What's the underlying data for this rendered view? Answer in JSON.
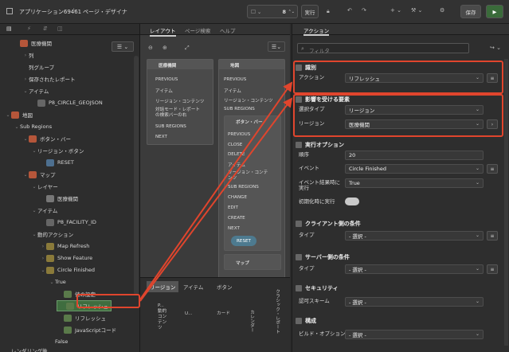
{
  "topbar": {
    "app_title": "アプリケーション69461",
    "page_title": "ページ・デザイナ",
    "page_number": "8",
    "run_label": "実行",
    "save_label": "保存"
  },
  "left": {
    "items": [
      {
        "label": "医療機関",
        "indent": 1,
        "icon": "region"
      },
      {
        "label": "列",
        "indent": 2,
        "chev": "›"
      },
      {
        "label": "列グループ",
        "indent": 2
      },
      {
        "label": "保存されたレポート",
        "indent": 2,
        "chev": "›"
      },
      {
        "label": "アイテム",
        "indent": 2,
        "chev": "⌄"
      },
      {
        "label": "P8_CIRCLE_GEOJSON",
        "indent": 3,
        "icon": "hidden"
      },
      {
        "label": "地図",
        "indent": 0,
        "chev": "⌄",
        "icon": "region"
      },
      {
        "label": "Sub Regions",
        "indent": 1,
        "chev": "⌄"
      },
      {
        "label": "ボタン・バー",
        "indent": 2,
        "chev": "⌄",
        "icon": "region"
      },
      {
        "label": "リージョン・ボタン",
        "indent": 3,
        "chev": "⌄"
      },
      {
        "label": "RESET",
        "indent": 4,
        "icon": "button"
      },
      {
        "label": "マップ",
        "indent": 2,
        "chev": "⌄",
        "icon": "map"
      },
      {
        "label": "レイヤー",
        "indent": 3,
        "chev": "⌄"
      },
      {
        "label": "医療機関",
        "indent": 4,
        "icon": "layer"
      },
      {
        "label": "アイテム",
        "indent": 3,
        "chev": "⌄"
      },
      {
        "label": "P8_FACILITY_ID",
        "indent": 4,
        "icon": "hidden"
      },
      {
        "label": "動的アクション",
        "indent": 3,
        "chev": "⌄"
      },
      {
        "label": "Map Refresh",
        "indent": 4,
        "chev": "›",
        "icon": "da"
      },
      {
        "label": "Show Feature",
        "indent": 4,
        "chev": "›",
        "icon": "da"
      },
      {
        "label": "Circle Finished",
        "indent": 4,
        "chev": "⌄",
        "icon": "da"
      },
      {
        "label": "True",
        "indent": 5,
        "chev": "⌄"
      },
      {
        "label": "値の設定",
        "indent": 6,
        "icon": "act"
      },
      {
        "label": "リフレッシュ",
        "indent": 6,
        "icon": "act",
        "selected": true
      },
      {
        "label": "リフレッシュ",
        "indent": 6,
        "icon": "act"
      },
      {
        "label": "JavaScriptコード",
        "indent": 6,
        "icon": "act"
      },
      {
        "label": "False",
        "indent": 5
      },
      {
        "label": "レンダリング後",
        "indent": 0
      }
    ]
  },
  "mid": {
    "tabs": [
      "レイアウト",
      "ページ検索",
      "ヘルプ"
    ],
    "card1": {
      "title": "医療機関",
      "rows": [
        "PREVIOUS",
        "アイテム",
        "リージョン・コンテンツ",
        "対話モード・レポート\nの検索バーの右",
        "SUB REGIONS",
        "NEXT"
      ]
    },
    "card2": {
      "title": "地図",
      "rows": [
        "PREVIOUS",
        "アイテム",
        "リージョン・コンテンツ",
        "SUB REGIONS"
      ]
    },
    "card3": {
      "title": "ボタン・バー",
      "rows": [
        "PREVIOUS",
        "CLOSE",
        "DELETE",
        "アイテム",
        "リージョン・コンテ\nンツ",
        "SUB REGIONS",
        "CHANGE",
        "EDIT",
        "CREATE",
        "NEXT"
      ]
    },
    "reset": "RESET",
    "card4": "マップ",
    "btabs": [
      "リージョン",
      "アイテム",
      "ボタン"
    ],
    "gallery": [
      "P...\n動的コンテンツ",
      "U...",
      "カード",
      "カレンダー",
      "クラシック・レポート"
    ]
  },
  "right": {
    "tab": "アクション",
    "filter_placeholder": "フィルタ",
    "sections": [
      {
        "title": "識別",
        "rows": [
          {
            "label": "アクション",
            "value": "リフレッシュ",
            "btn": "≡"
          }
        ]
      },
      {
        "title": "影響を受ける要素",
        "rows": [
          {
            "label": "選択タイプ",
            "value": "リージョン"
          },
          {
            "label": "リージョン",
            "value": "医療機関",
            "btn": "›"
          }
        ]
      },
      {
        "title": "実行オプション",
        "rows": [
          {
            "label": "順序",
            "value": "20"
          },
          {
            "label": "イベント",
            "value": "Circle Finished",
            "btn": "≡"
          },
          {
            "label": "イベント結果時に\n実行",
            "value": "True"
          },
          {
            "label": "初期化時に実行",
            "value": ""
          }
        ]
      },
      {
        "title": "クライアント側の条件",
        "rows": [
          {
            "label": "タイプ",
            "value": "- 選択 -",
            "btn": "≡"
          }
        ]
      },
      {
        "title": "サーバー側の条件",
        "rows": [
          {
            "label": "タイプ",
            "value": "- 選択 -",
            "btn": "≡"
          }
        ]
      },
      {
        "title": "セキュリティ",
        "rows": [
          {
            "label": "認可スキーム",
            "value": "- 選択 -"
          }
        ]
      },
      {
        "title": "構成",
        "rows": [
          {
            "label": "ビルド・オプション",
            "value": "- 選択 -"
          }
        ]
      }
    ]
  },
  "colors": {
    "accent": "#e0452d",
    "toggle_bg": "#c9c9c9"
  }
}
